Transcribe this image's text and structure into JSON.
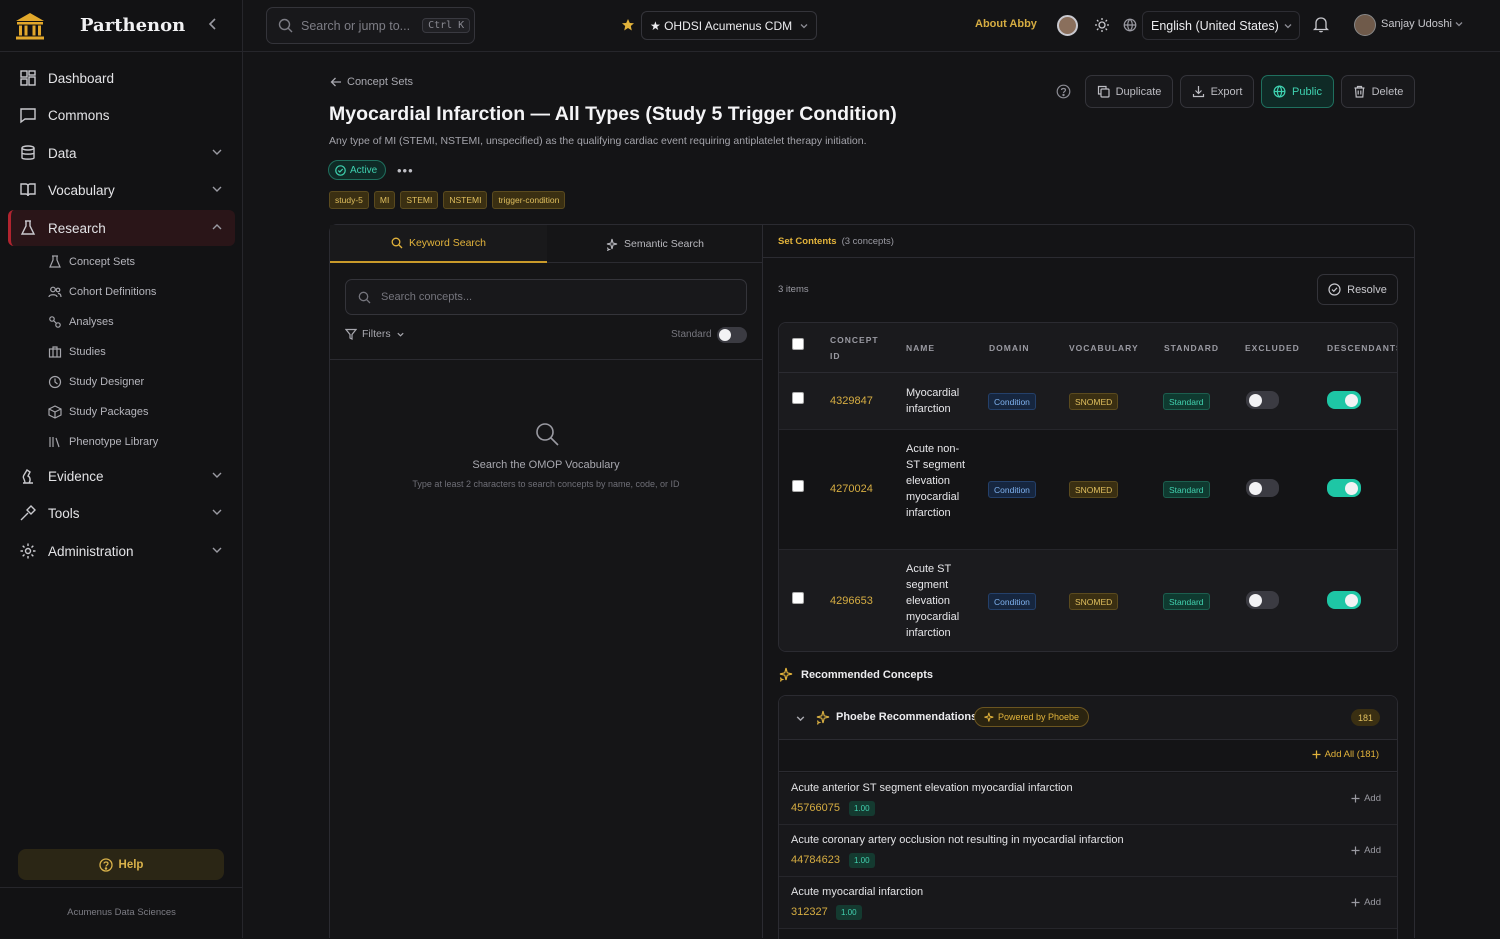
{
  "brand": {
    "name": "Parthenon"
  },
  "nav": {
    "items": [
      {
        "label": "Dashboard",
        "icon": "dashboard-icon"
      },
      {
        "label": "Commons",
        "icon": "chat-icon"
      },
      {
        "label": "Data",
        "icon": "database-icon"
      },
      {
        "label": "Vocabulary",
        "icon": "book-icon"
      },
      {
        "label": "Research",
        "icon": "flask-icon",
        "active": true
      },
      {
        "label": "Evidence",
        "icon": "evidence-icon"
      },
      {
        "label": "Tools",
        "icon": "tools-icon"
      },
      {
        "label": "Administration",
        "icon": "gear-icon"
      }
    ],
    "research_sub": [
      {
        "label": "Concept Sets",
        "icon": "flask-small-icon"
      },
      {
        "label": "Cohort Definitions",
        "icon": "users-icon"
      },
      {
        "label": "Analyses",
        "icon": "analyses-icon"
      },
      {
        "label": "Studies",
        "icon": "briefcase-icon"
      },
      {
        "label": "Study Designer",
        "icon": "designer-icon"
      },
      {
        "label": "Study Packages",
        "icon": "package-icon"
      },
      {
        "label": "Phenotype Library",
        "icon": "library-icon"
      }
    ],
    "help": "Help",
    "footer": "Acumenus Data Sciences"
  },
  "topbar": {
    "search_placeholder": "Search or jump to...",
    "shortcut": "Ctrl K",
    "source": "★ OHDSI Acumenus CDM",
    "about": "About Abby",
    "language": "English (United States)",
    "user": "Sanjay Udoshi"
  },
  "page": {
    "breadcrumb": "Concept Sets",
    "title": "Myocardial Infarction — All Types (Study 5 Trigger Condition)",
    "description": "Any type of MI (STEMI, NSTEMI, unspecified) as the qualifying cardiac event requiring antiplatelet therapy initiation.",
    "status": "Active",
    "more": "•••",
    "tags": [
      "study-5",
      "MI",
      "STEMI",
      "NSTEMI",
      "trigger-condition"
    ],
    "actions": {
      "duplicate": "Duplicate",
      "export": "Export",
      "public": "Public",
      "delete": "Delete"
    }
  },
  "search_panel": {
    "tabs": [
      "Keyword Search",
      "Semantic Search"
    ],
    "placeholder": "Search concepts...",
    "filters": "Filters",
    "standard_label": "Standard",
    "empty_title": "Search the OMOP Vocabulary",
    "empty_sub": "Type at least 2 characters to search concepts by name, code, or ID"
  },
  "set_contents": {
    "title": "Set Contents",
    "count": "(3 concepts)",
    "items": "3 items",
    "resolve": "Resolve",
    "columns": [
      "CONCEPT ID",
      "NAME",
      "DOMAIN",
      "VOCABULARY",
      "STANDARD",
      "EXCLUDED",
      "DESCENDANTS"
    ],
    "rows": [
      {
        "id": "4329847",
        "name": "Myocardial infarction",
        "domain": "Condition",
        "vocabulary": "SNOMED",
        "standard": "Standard",
        "excluded": false,
        "descendants": true
      },
      {
        "id": "4270024",
        "name": "Acute non-ST segment elevation myocardial infarction",
        "domain": "Condition",
        "vocabulary": "SNOMED",
        "standard": "Standard",
        "excluded": false,
        "descendants": true
      },
      {
        "id": "4296653",
        "name": "Acute ST segment elevation myocardial infarction",
        "domain": "Condition",
        "vocabulary": "SNOMED",
        "standard": "Standard",
        "excluded": false,
        "descendants": true
      }
    ]
  },
  "recommended": {
    "header": "Recommended Concepts",
    "box_title": "Phoebe Recommendations",
    "powered": "Powered by Phoebe",
    "count": "181",
    "add_all": "Add All (181)",
    "add": "Add",
    "items": [
      {
        "name": "Acute anterior ST segment elevation myocardial infarction",
        "id": "45766075",
        "score": "1.00"
      },
      {
        "name": "Acute coronary artery occlusion not resulting in myocardial infarction",
        "id": "44784623",
        "score": "1.00"
      },
      {
        "name": "Acute myocardial infarction",
        "id": "312327",
        "score": "1.00"
      }
    ]
  },
  "colors": {
    "accent": "#e2b33b",
    "teal": "#1ec6a5",
    "active_nav": "#b0242f"
  }
}
